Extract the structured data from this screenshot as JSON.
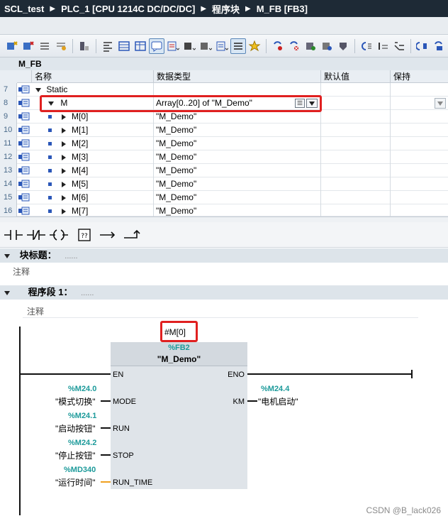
{
  "titlebar": {
    "project": "SCL_test",
    "plc": "PLC_1 [CPU 1214C DC/DC/DC]",
    "folder": "程序块",
    "block": "M_FB [FB3]"
  },
  "block_name": "M_FB",
  "interface": {
    "headers": {
      "name": "名称",
      "datatype": "数据类型",
      "default": "默认值",
      "retain": "保持"
    },
    "rows": [
      {
        "num": "7",
        "name": "Static",
        "dtype": ""
      },
      {
        "num": "8",
        "name": "M",
        "dtype": "Array[0..20] of \"M_Demo\""
      },
      {
        "num": "9",
        "name": "M[0]",
        "dtype": "\"M_Demo\""
      },
      {
        "num": "10",
        "name": "M[1]",
        "dtype": "\"M_Demo\""
      },
      {
        "num": "11",
        "name": "M[2]",
        "dtype": "\"M_Demo\""
      },
      {
        "num": "12",
        "name": "M[3]",
        "dtype": "\"M_Demo\""
      },
      {
        "num": "13",
        "name": "M[4]",
        "dtype": "\"M_Demo\""
      },
      {
        "num": "14",
        "name": "M[5]",
        "dtype": "\"M_Demo\""
      },
      {
        "num": "15",
        "name": "M[6]",
        "dtype": "\"M_Demo\""
      },
      {
        "num": "16",
        "name": "M[7]",
        "dtype": "\"M_Demo\""
      }
    ]
  },
  "block_title": {
    "label": "块标题：",
    "dots": "......",
    "comment": "注释"
  },
  "network": {
    "label": "程序段 1：",
    "dots": "......",
    "comment": "注释"
  },
  "fb": {
    "instance": "#M[0]",
    "address": "%FB2",
    "name": "\"M_Demo\"",
    "pin_en": "EN",
    "pin_eno": "ENO",
    "inputs": [
      {
        "pin": "MODE",
        "addr": "%M24.0",
        "symbol": "\"模式切换\""
      },
      {
        "pin": "RUN",
        "addr": "%M24.1",
        "symbol": "\"启动按钮\""
      },
      {
        "pin": "STOP",
        "addr": "%M24.2",
        "symbol": "\"停止按钮\""
      },
      {
        "pin": "RUN_TIME",
        "addr": "%MD340",
        "symbol": "\"运行时间\""
      }
    ],
    "output": {
      "pin": "KM",
      "addr": "%M24.4",
      "symbol": "\"电机启动\""
    }
  },
  "watermark": "CSDN @B_lack026",
  "colors": {
    "titlebar": "#1e2a36",
    "address": "#1c9a9a",
    "highlight": "#e02020"
  }
}
